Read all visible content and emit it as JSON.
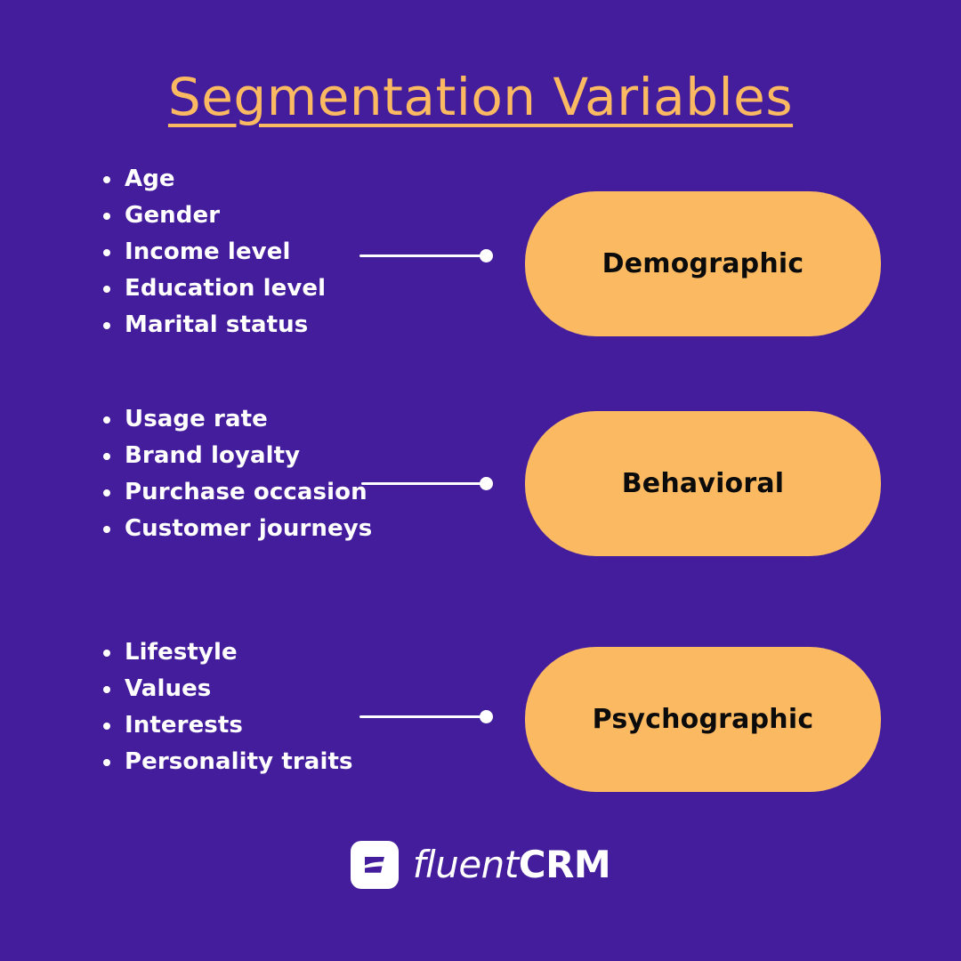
{
  "poster": {
    "title": "Segmentation Variables",
    "background_color": "#441D9D",
    "accent_color": "#FBBA62",
    "text_color": "#FFFFFF",
    "pill_text_color": "#0B0B0B"
  },
  "rows": [
    {
      "category": "Demographic",
      "items": [
        "Age",
        "Gender",
        "Income level",
        "Education level",
        "Marital status"
      ]
    },
    {
      "category": "Behavioral",
      "items": [
        "Usage rate",
        "Brand loyalty",
        "Purchase occasion",
        "Customer journeys"
      ]
    },
    {
      "category": "Psychographic",
      "items": [
        "Lifestyle",
        "Values",
        "Interests",
        "Personality traits"
      ]
    }
  ],
  "logo": {
    "mark": "fluentcrm-flag-icon",
    "name_light": "fluent",
    "name_bold": "CRM"
  }
}
